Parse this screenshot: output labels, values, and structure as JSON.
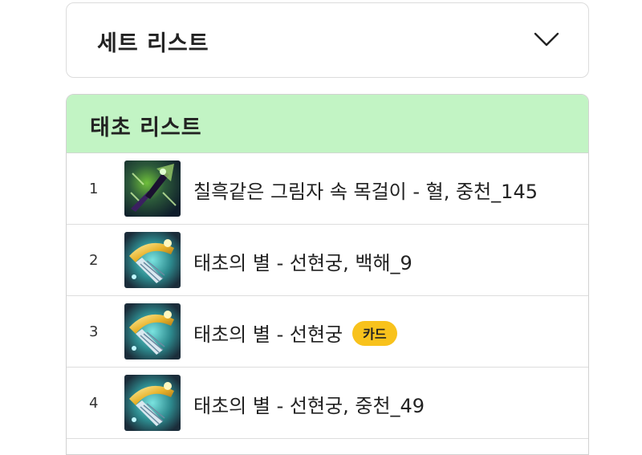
{
  "set_list": {
    "title": "세트 리스트",
    "toggle_icon": "chevron-down-icon"
  },
  "taecho_list": {
    "title": "태초 리스트",
    "header_color": "#c2f4c4",
    "items": [
      {
        "rank": "1",
        "name": "칠흑같은 그림자 속 목걸이 - 혈, 중천_145",
        "badge": "",
        "icon": "dark-necklace-icon"
      },
      {
        "rank": "2",
        "name": "태초의 별 - 선현궁, 백해_9",
        "badge": "",
        "icon": "golden-bow-icon"
      },
      {
        "rank": "3",
        "name": "태초의 별 - 선현궁",
        "badge": "카드",
        "icon": "golden-bow-icon"
      },
      {
        "rank": "4",
        "name": "태초의 별 - 선현궁, 중천_49",
        "badge": "",
        "icon": "golden-bow-icon"
      }
    ]
  },
  "colors": {
    "badge": "#f8c21c",
    "border": "#dcdcdc"
  }
}
